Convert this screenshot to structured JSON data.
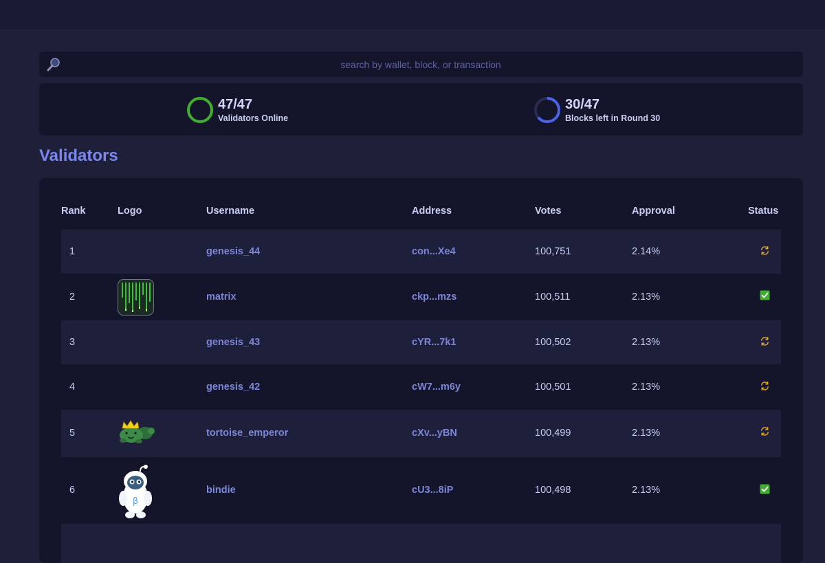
{
  "search": {
    "placeholder": "search by wallet, block, or transaction"
  },
  "stats": [
    {
      "value": "47/47",
      "label": "Validators Online",
      "progress": 1.0,
      "color": "#3fb02e"
    },
    {
      "value": "30/47",
      "label": "Blocks left in Round 30",
      "progress": 0.64,
      "color": "#4d63e6"
    }
  ],
  "section_title": "Validators",
  "table": {
    "headers": {
      "rank": "Rank",
      "logo": "Logo",
      "username": "Username",
      "address": "Address",
      "votes": "Votes",
      "approval": "Approval",
      "status": "Status"
    },
    "rows": [
      {
        "rank": "1",
        "logo": "none",
        "username": "genesis_44",
        "address": "con...Xe4",
        "votes": "100,751",
        "approval": "2.14%",
        "status": "syncing"
      },
      {
        "rank": "2",
        "logo": "matrix-logo",
        "username": "matrix",
        "address": "ckp...mzs",
        "votes": "100,511",
        "approval": "2.13%",
        "status": "active"
      },
      {
        "rank": "3",
        "logo": "none",
        "username": "genesis_43",
        "address": "cYR...7k1",
        "votes": "100,502",
        "approval": "2.13%",
        "status": "syncing"
      },
      {
        "rank": "4",
        "logo": "none",
        "username": "genesis_42",
        "address": "cW7...m6y",
        "votes": "100,501",
        "approval": "2.13%",
        "status": "syncing"
      },
      {
        "rank": "5",
        "logo": "tortoise-logo",
        "username": "tortoise_emperor",
        "address": "cXv...yBN",
        "votes": "100,499",
        "approval": "2.13%",
        "status": "syncing"
      },
      {
        "rank": "6",
        "logo": "bindie-logo",
        "username": "bindie",
        "address": "cU3...8iP",
        "votes": "100,498",
        "approval": "2.13%",
        "status": "active"
      }
    ]
  },
  "colors": {
    "accent": "#7b86ef",
    "status_active": "#3fb02e",
    "status_syncing": "#e0a72b"
  }
}
